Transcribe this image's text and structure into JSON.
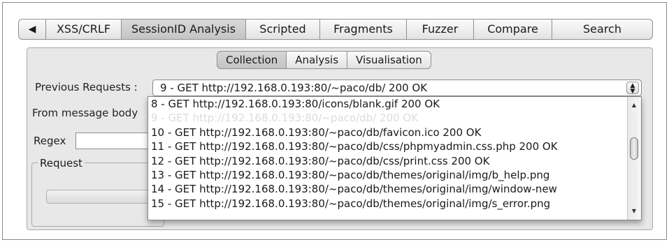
{
  "tabs": {
    "prev_arrow": "◀",
    "items": [
      "XSS/CRLF",
      "SessionID Analysis",
      "Scripted",
      "Fragments",
      "Fuzzer",
      "Compare",
      "Search"
    ],
    "active_index": 1
  },
  "subtabs": {
    "items": [
      "Collection",
      "Analysis",
      "Visualisation"
    ],
    "active_index": 0
  },
  "form": {
    "previous_requests_label": "Previous Requests :",
    "selected_request": "9 - GET http://192.168.0.193:80/~paco/db/    200 OK",
    "from_message_body_label": "From message body",
    "regex_label": "Regex",
    "regex_value": "",
    "request_group_label": "Request"
  },
  "dropdown": {
    "items": [
      "8 - GET http://192.168.0.193:80/icons/blank.gif    200 OK",
      "9 - GET http://192.168.0.193:80/~paco/db/    200 OK",
      "10 - GET http://192.168.0.193:80/~paco/db/favicon.ico    200 OK",
      "11 - GET http://192.168.0.193:80/~paco/db/css/phpmyadmin.css.php    200 OK",
      "12 - GET http://192.168.0.193:80/~paco/db/css/print.css    200 OK",
      "13 - GET http://192.168.0.193:80/~paco/db/themes/original/img/b_help.png",
      "14 - GET http://192.168.0.193:80/~paco/db/themes/original/img/window-new",
      "15 - GET http://192.168.0.193:80/~paco/db/themes/original/img/s_error.png"
    ],
    "highlighted_index": 1
  },
  "colors": {
    "panel_bg": "#e8e8e8",
    "active_tab_bg": "#c9c9c9",
    "border": "#8f8f8f"
  }
}
